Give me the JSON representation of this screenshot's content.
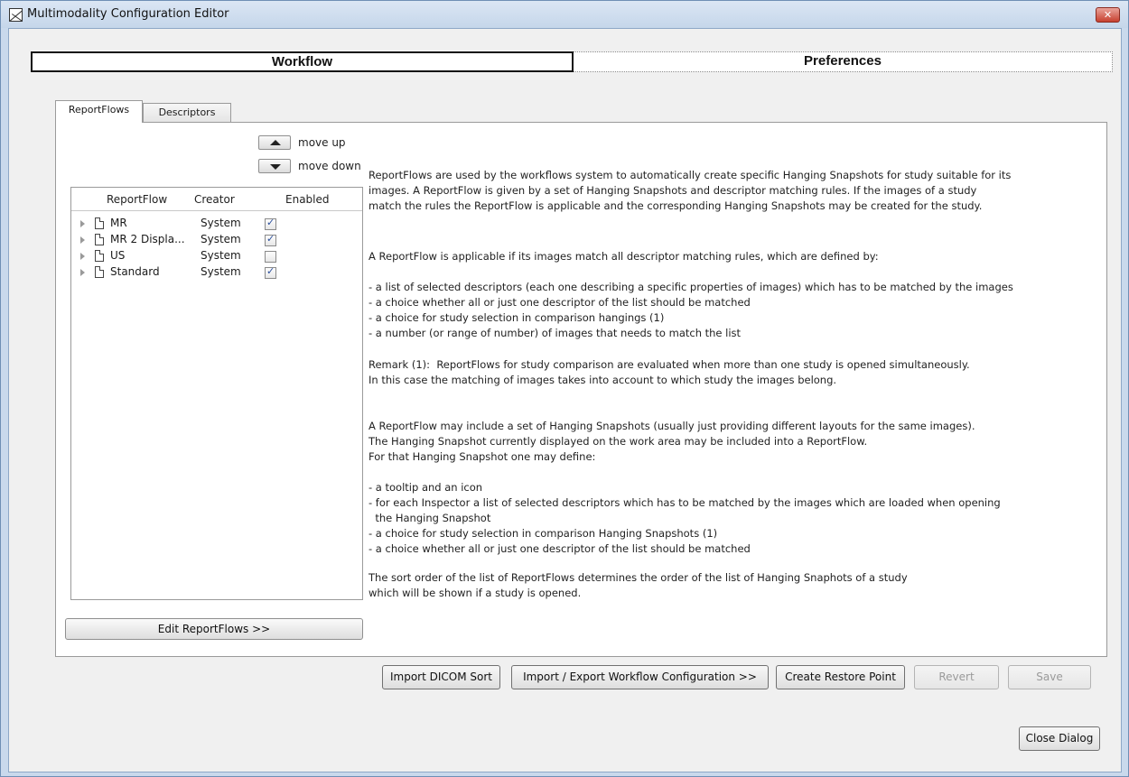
{
  "window": {
    "title": "Multimodality Configuration Editor",
    "close_label": "✕"
  },
  "main_tabs": [
    {
      "label": "Workflow",
      "active": true
    },
    {
      "label": "Preferences",
      "active": false
    }
  ],
  "inner_tabs": [
    {
      "label": "ReportFlows",
      "active": true
    },
    {
      "label": "Descriptors",
      "active": false
    }
  ],
  "move": {
    "up_label": "move up",
    "down_label": "move down"
  },
  "table": {
    "headers": {
      "name": "ReportFlow",
      "creator": "Creator",
      "enabled": "Enabled"
    },
    "rows": [
      {
        "name": "MR",
        "creator": "System",
        "enabled": true
      },
      {
        "name": "MR 2 Displa...",
        "creator": "System",
        "enabled": true
      },
      {
        "name": "US",
        "creator": "System",
        "enabled": false
      },
      {
        "name": "Standard",
        "creator": "System",
        "enabled": true
      }
    ]
  },
  "edit_button": "Edit ReportFlows >>",
  "description": {
    "p1": "ReportFlows are used by the workflows system to automatically create specific Hanging Snapshots for study suitable for its\nimages. A ReportFlow is given by a set of Hanging Snapshots and descriptor matching rules. If the images of a study\nmatch the rules the ReportFlow is applicable and the corresponding Hanging Snapshots may be created for the study.",
    "p2": "A ReportFlow is applicable if its images match all descriptor matching rules, which are defined by:",
    "p3": "- a list of selected descriptors (each one describing a specific properties of images) which has to be matched by the images\n- a choice whether all or just one descriptor of the list should be matched\n- a choice for study selection in comparison hangings (1)\n- a number (or range of number) of images that needs to match the list",
    "p4": "Remark (1):  ReportFlows for study comparison are evaluated when more than one study is opened simultaneously.\nIn this case the matching of images takes into account to which study the images belong.",
    "p5": "A ReportFlow may include a set of Hanging Snapshots (usually just providing different layouts for the same images).\nThe Hanging Snapshot currently displayed on the work area may be included into a ReportFlow.\nFor that Hanging Snapshot one may define:",
    "p6": "- a tooltip and an icon\n- for each Inspector a list of selected descriptors which has to be matched by the images which are loaded when opening\n  the Hanging Snapshot\n- a choice for study selection in comparison Hanging Snapshots (1)\n- a choice whether all or just one descriptor of the list should be matched",
    "p7": "The sort order of the list of ReportFlows determines the order of the list of Hanging Snaphots of a study\nwhich will be shown if a study is opened."
  },
  "buttons": {
    "import_dicom": "Import DICOM Sort",
    "import_export": "Import / Export Workflow Configuration  >>",
    "restore_point": "Create Restore Point",
    "revert": "Revert",
    "save": "Save",
    "close_dialog": "Close Dialog"
  }
}
